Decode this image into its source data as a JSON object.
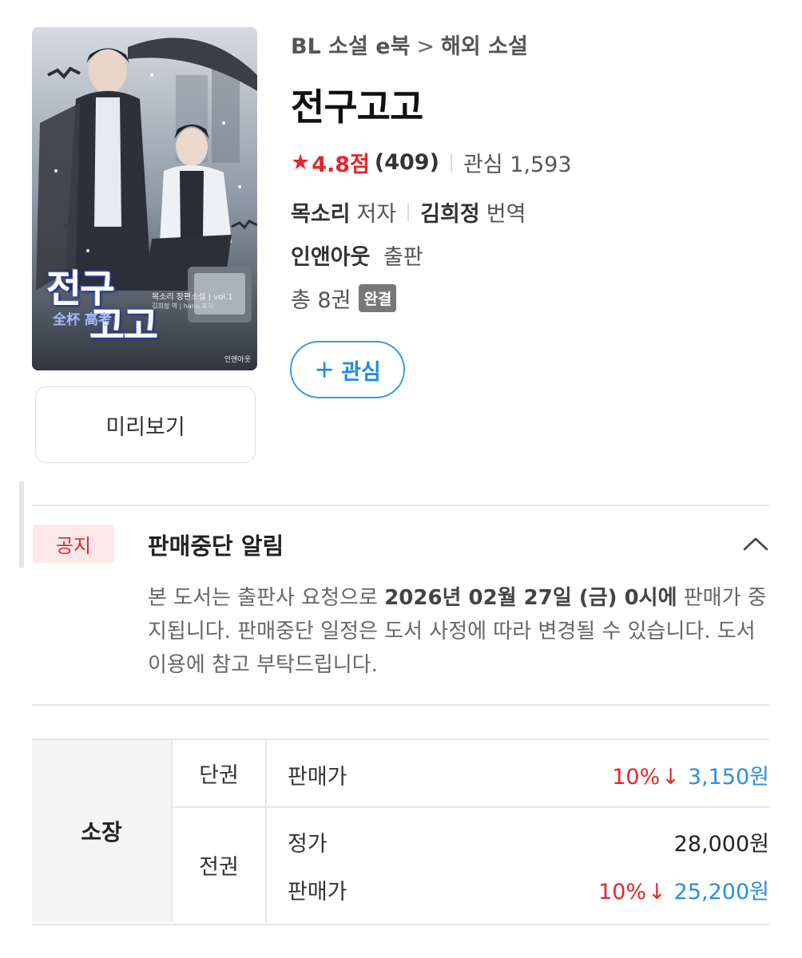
{
  "cover": {
    "title_line1": "전구",
    "title_line2": "고고",
    "subtitle": "목소리 장편소설 | vol.1",
    "credits": "김희정 역 | hanu 표지",
    "cjk_title": "全杯 高考",
    "publisher_logo": "인앤아웃"
  },
  "preview_button": "미리보기",
  "breadcrumb": {
    "category": "BL 소설 e북",
    "separator": ">",
    "subcategory": "해외 소설"
  },
  "title": "전구고고",
  "rating": {
    "star_icon": "★",
    "score": "4.8점",
    "count": "(409)",
    "interest_label": "관심 1,593"
  },
  "author": {
    "name": "목소리",
    "role": "저자"
  },
  "translator": {
    "name": "김희정",
    "role": "번역"
  },
  "publisher": {
    "name": "인앤아웃",
    "role": "출판"
  },
  "volumes": {
    "text": "총 8권",
    "badge": "완결"
  },
  "interest_button": {
    "icon": "+",
    "label": "관심"
  },
  "notice": {
    "badge": "공지",
    "title": "판매중단 알림",
    "body_prefix": "본 도서는 출판사 요청으로 ",
    "body_bold": "2026년 02월 27일 (금) 0시에",
    "body_suffix": " 판매가 중지됩니다. 판매중단 일정은 도서 사정에 따라 변경될 수 있습니다. 도서 이용에 참고 부탁드립니다."
  },
  "price": {
    "ownership_label": "소장",
    "single": {
      "label": "단권",
      "sale_label": "판매가",
      "discount": "10%",
      "arrow": "↓",
      "sale_price": "3,150원"
    },
    "full_set": {
      "label": "전권",
      "regular_label": "정가",
      "regular_price": "28,000원",
      "sale_label": "판매가",
      "discount": "10%",
      "arrow": "↓",
      "sale_price": "25,200원"
    }
  },
  "colors": {
    "accent_red": "#e0282e",
    "accent_blue": "#2b8fe0",
    "button_border_blue": "#3b9be0"
  }
}
